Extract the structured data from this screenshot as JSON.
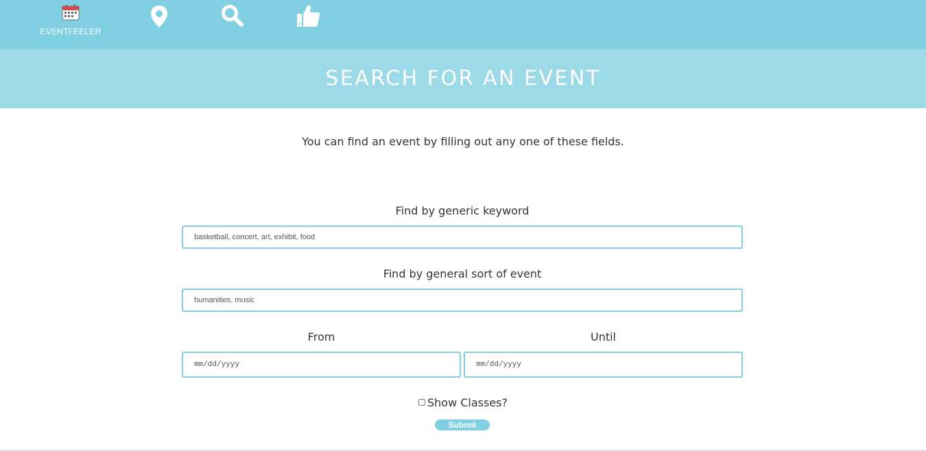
{
  "nav": {
    "brand_label": "EVENTFEELER",
    "items": [
      {
        "name": "calendar-icon"
      },
      {
        "name": "map-pin-icon"
      },
      {
        "name": "search-icon"
      },
      {
        "name": "thumbs-up-icon"
      }
    ]
  },
  "colors": {
    "nav_bg": "#80cfe2",
    "banner_bg": "#9bdae6",
    "accent": "#80cfe2"
  },
  "banner": {
    "title": "SEARCH FOR AN EVENT"
  },
  "intro": "You can find an event by filling out any one of these fields.",
  "form": {
    "keyword": {
      "label": "Find by generic keyword",
      "placeholder": "basketball, concert, art, exhibit, food",
      "value": ""
    },
    "sort": {
      "label": "Find by general sort of event",
      "placeholder": "humanities, music",
      "value": ""
    },
    "from": {
      "label": "From",
      "placeholder": "mm/dd/yyyy"
    },
    "until": {
      "label": "Until",
      "placeholder": "mm/dd/yyyy"
    },
    "show_classes": {
      "label": "Show Classes?",
      "checked": false
    },
    "submit_label": "Submit"
  }
}
